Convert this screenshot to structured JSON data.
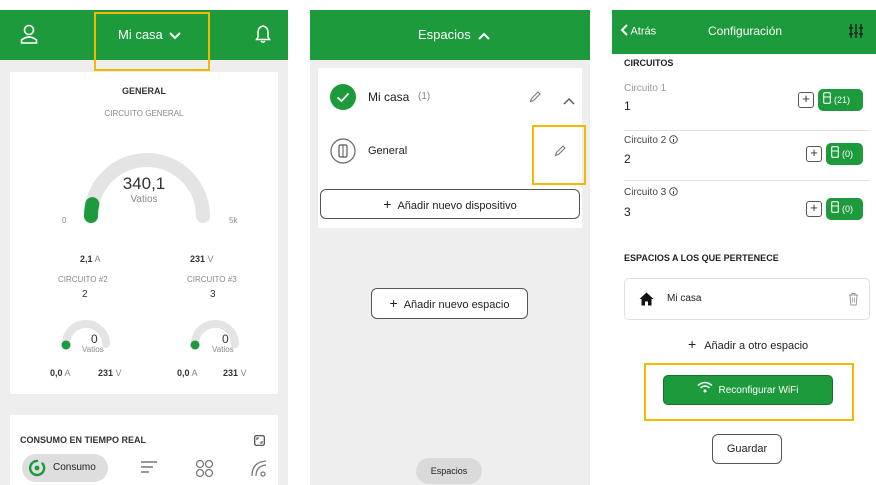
{
  "panel1": {
    "header": {
      "title": "Mi casa"
    },
    "general": {
      "title": "GENERAL",
      "subtitle": "CIRCUITO GENERAL",
      "value": "340,1",
      "unit": "Vatios",
      "min": "0",
      "max": "5k",
      "level": 0.068,
      "amps": "2,1",
      "amps_unit": "A",
      "volts": "231",
      "volts_unit": "V"
    },
    "circuits": [
      {
        "label": "CIRCUITO #2",
        "number": "2",
        "value": "0",
        "unit": "Vatios",
        "amps": "0,0",
        "amps_unit": "A",
        "volts": "231",
        "volts_unit": "V"
      },
      {
        "label": "CIRCUITO #3",
        "number": "3",
        "value": "0",
        "unit": "Vatios",
        "amps": "0,0",
        "amps_unit": "A",
        "volts": "231",
        "volts_unit": "V"
      }
    ],
    "realtime": {
      "title": "CONSUMO EN TIEMPO REAL"
    },
    "bottom_nav": {
      "consumo": "Consumo"
    }
  },
  "panel2": {
    "header": {
      "title": "Espacios"
    },
    "space": {
      "name": "Mi casa",
      "count": "(1)"
    },
    "device": {
      "name": "General"
    },
    "add_device": "Añadir nuevo dispositivo",
    "add_space": "Añadir nuevo espacio",
    "bottom_pill": "Espacios"
  },
  "panel3": {
    "header": {
      "back": "Atrás",
      "title": "Configuración"
    },
    "section_circuits": "CIRCUITOS",
    "circuits": [
      {
        "label": "Circuito 1",
        "value": "1",
        "count": "(21)"
      },
      {
        "label": "Circuito 2",
        "value": "2",
        "count": "(0)"
      },
      {
        "label": "Circuito 3",
        "value": "3",
        "count": "(0)"
      }
    ],
    "section_spaces": "ESPACIOS A LOS QUE PERTENECE",
    "space": "Mi casa",
    "add_space": "Añadir a otro espacio",
    "wifi_button": "Reconfigurar WiFi",
    "save_button": "Guardar"
  },
  "colors": {
    "brand": "#1c9a3c",
    "highlight": "#f5b800"
  }
}
